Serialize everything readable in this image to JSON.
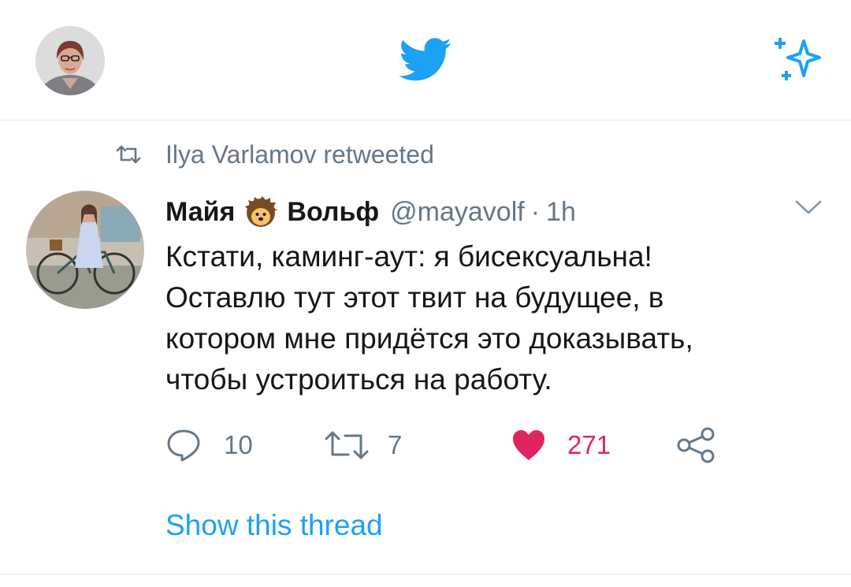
{
  "header": {
    "account_avatar": "profile-avatar",
    "logo": "twitter-bird-icon",
    "sparkle": "sparkle-icon",
    "brand_color": "#1da1f2"
  },
  "tweet": {
    "retweet_notice": "Ilya Varlamov retweeted",
    "author": {
      "name_first": "Майя",
      "name_emoji": "hedgehog-emoji",
      "name_last": "Вольф",
      "handle": "@mayavolf",
      "separator": "·",
      "time": "1h"
    },
    "text_lines": [
      "Кстати, каминг-аут: я бисексуальна!",
      "Оставлю тут этот твит на будущее, в",
      "котором мне придётся это доказывать,",
      "чтобы устроиться на работу."
    ],
    "actions": {
      "replies": "10",
      "retweets": "7",
      "likes": "271",
      "like_color": "#e0245e"
    },
    "show_thread": "Show this thread"
  }
}
